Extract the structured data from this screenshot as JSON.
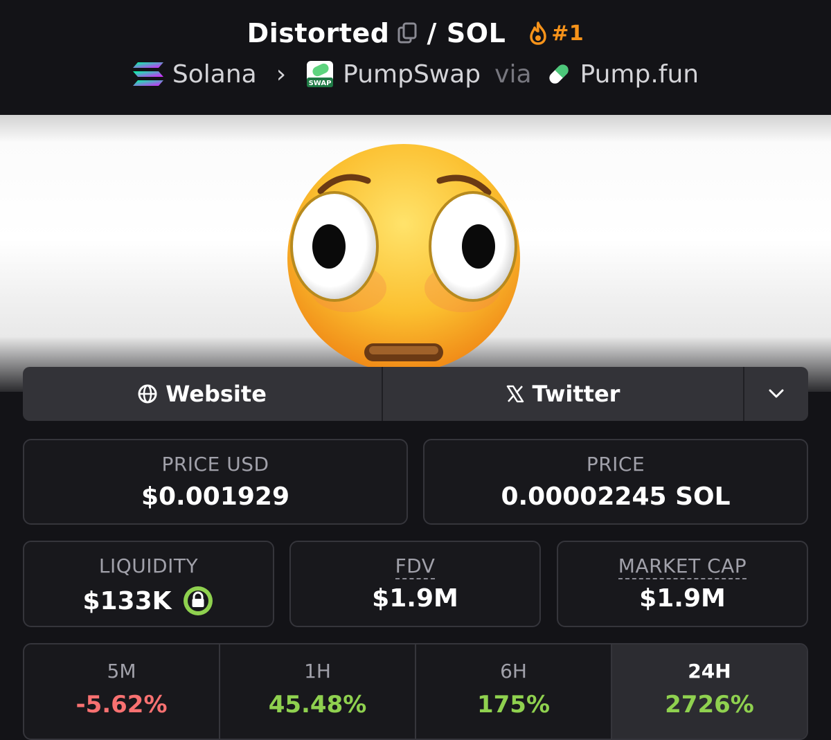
{
  "header": {
    "token_name": "Distorted",
    "separator": "/",
    "quote": "SOL",
    "rank": "#1",
    "chain": "Solana",
    "dex": "PumpSwap",
    "dex_badge": "SWAP",
    "via": "via",
    "launchpad": "Pump.fun"
  },
  "links": {
    "website": "Website",
    "twitter": "Twitter"
  },
  "stats": {
    "price_usd_label": "PRICE USD",
    "price_usd": "$0.001929",
    "price_label": "PRICE",
    "price_sol": "0.00002245 SOL",
    "liquidity_label": "LIQUIDITY",
    "liquidity": "$133K",
    "fdv_label": "FDV",
    "fdv": "$1.9M",
    "mcap_label": "MARKET CAP",
    "mcap": "$1.9M"
  },
  "changes": [
    {
      "label": "5M",
      "value": "-5.62%",
      "color": "#f87171"
    },
    {
      "label": "1H",
      "value": "45.48%",
      "color": "#8fd14f"
    },
    {
      "label": "6H",
      "value": "175%",
      "color": "#8fd14f"
    },
    {
      "label": "24H",
      "value": "2726%",
      "color": "#8fd14f"
    }
  ],
  "colors": {
    "background": "#131317",
    "rank_orange": "#f7931a",
    "positive": "#8fd14f",
    "negative": "#f87171"
  },
  "icons": [
    "copy-icon",
    "fire-icon",
    "solana-logo-icon",
    "chevron-right-icon",
    "pumpswap-logo-icon",
    "pill-icon",
    "globe-icon",
    "x-logo-icon",
    "chevron-down-icon",
    "lock-icon"
  ]
}
